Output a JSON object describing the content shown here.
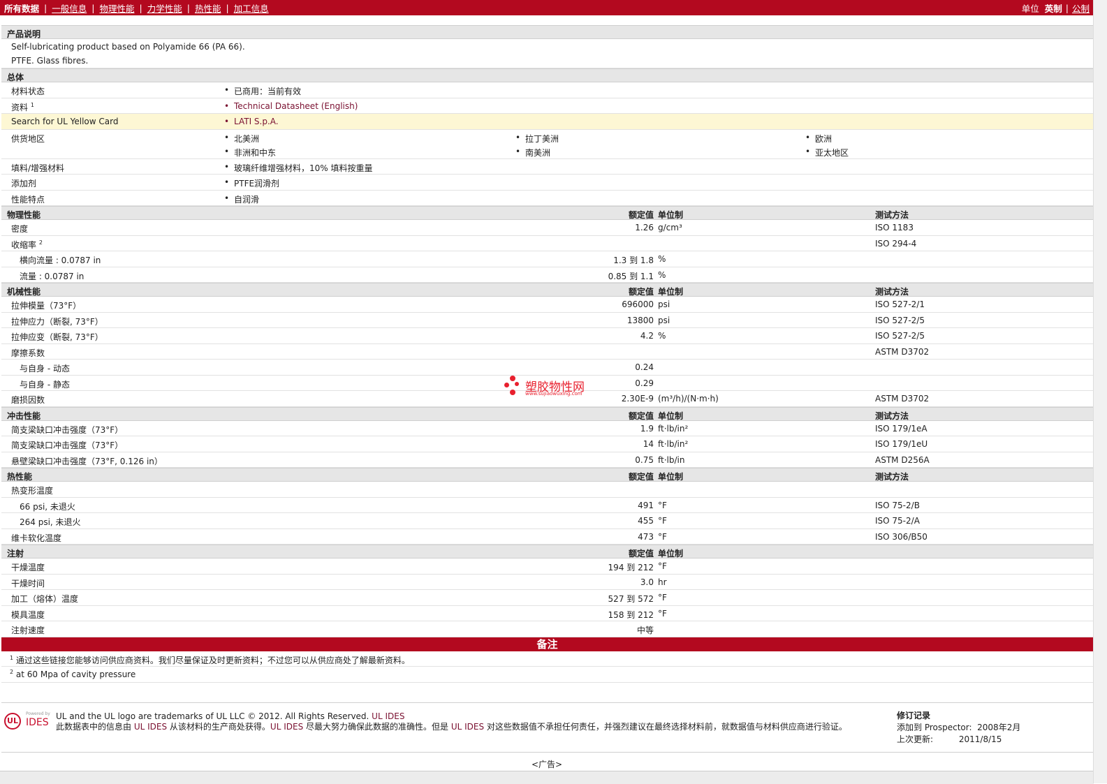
{
  "nav": {
    "items": [
      "所有数据",
      "一般信息",
      "物理性能",
      "力学性能",
      "热性能",
      "加工信息"
    ],
    "units_label": "单位",
    "unit_imperial": "英制",
    "unit_metric": "公制"
  },
  "product": {
    "header": "产品说明",
    "line1": "Self-lubricating product based on Polyamide 66 (PA 66).",
    "line2": "PTFE. Glass fibres."
  },
  "general": {
    "header": "总体",
    "material_status_label": "材料状态",
    "material_status_value": "已商用：当前有效",
    "docs_label": "资料",
    "docs_sup": "1",
    "docs_value": "Technical Datasheet (English)",
    "ul_label": "Search for UL Yellow Card",
    "ul_value": "LATI S.p.A.",
    "supply_label": "供货地区",
    "regions": [
      "北美洲",
      "拉丁美洲",
      "欧洲",
      "非洲和中东",
      "南美洲",
      "亚太地区"
    ],
    "filler_label": "填料/增强材料",
    "filler_value": "玻璃纤维增强材料，10% 填料按重量",
    "additive_label": "添加剂",
    "additive_value": "PTFE润滑剂",
    "feature_label": "性能特点",
    "feature_value": "自润滑"
  },
  "headers": {
    "value": "额定值",
    "unit": "单位制",
    "method": "测试方法"
  },
  "physical": {
    "header": "物理性能",
    "density": {
      "label": "密度",
      "value": "1.26",
      "unit": "g/cm³",
      "method": "ISO 1183"
    },
    "shrink": {
      "label": "收缩率",
      "sup": "2",
      "method": "ISO 294-4"
    },
    "shrink_cross": {
      "label": "横向流量 : 0.0787 in",
      "value": "1.3 到  1.8",
      "unit": "%"
    },
    "shrink_flow": {
      "label": "流量 : 0.0787 in",
      "value": "0.85 到  1.1",
      "unit": "%"
    }
  },
  "mechanical": {
    "header": "机械性能",
    "rows": [
      {
        "label": "拉伸模量（73°F）",
        "value": "696000",
        "unit": "psi",
        "method": "ISO 527-2/1"
      },
      {
        "label": "拉伸应力（断裂, 73°F）",
        "value": "13800",
        "unit": "psi",
        "method": "ISO 527-2/5"
      },
      {
        "label": "拉伸应变（断裂, 73°F）",
        "value": "4.2",
        "unit": "%",
        "method": "ISO 527-2/5"
      }
    ],
    "friction": {
      "label": "摩擦系数",
      "method": "ASTM D3702"
    },
    "friction_dyn": {
      "label": "与自身  - 动态",
      "value": "0.24"
    },
    "friction_sta": {
      "label": "与自身  - 静态",
      "value": "0.29"
    },
    "wear": {
      "label": "磨损因数",
      "value": "2.30E-9",
      "unit": "(m³/h)/(N·m·h)",
      "method": "ASTM D3702"
    }
  },
  "impact": {
    "header": "冲击性能",
    "rows": [
      {
        "label": "简支梁缺口冲击强度（73°F）",
        "value": "1.9",
        "unit": "ft·lb/in²",
        "method": "ISO 179/1eA"
      },
      {
        "label": "简支梁缺口冲击强度（73°F）",
        "value": "14",
        "unit": "ft·lb/in²",
        "method": "ISO 179/1eU"
      },
      {
        "label": "悬壁梁缺口冲击强度（73°F, 0.126 in）",
        "value": "0.75",
        "unit": "ft·lb/in",
        "method": "ASTM D256A"
      }
    ]
  },
  "thermal": {
    "header": "热性能",
    "hdt": {
      "label": "热变形温度"
    },
    "hdt66": {
      "label": "66 psi, 未退火",
      "value": "491",
      "unit": "°F",
      "method": "ISO 75-2/B"
    },
    "hdt264": {
      "label": "264 psi, 未退火",
      "value": "455",
      "unit": "°F",
      "method": "ISO 75-2/A"
    },
    "vicat": {
      "label": "维卡软化温度",
      "value": "473",
      "unit": "°F",
      "method": "ISO 306/B50"
    }
  },
  "injection": {
    "header": "注射",
    "rows": [
      {
        "label": "干燥温度",
        "value": "194 到  212",
        "unit": "°F"
      },
      {
        "label": "干燥时间",
        "value": "3.0",
        "unit": "hr"
      },
      {
        "label": "加工（熔体）温度",
        "value": "527 到  572",
        "unit": "°F"
      },
      {
        "label": "模具温度",
        "value": "158 到  212",
        "unit": "°F"
      },
      {
        "label": "注射速度",
        "value": "中等",
        "unit": ""
      }
    ]
  },
  "notes": {
    "header": "备注",
    "n1_sup": "1",
    "n1": "通过这些链接您能够访问供应商资料。我们尽量保证及时更新资料；不过您可以从供应商处了解最新资料。",
    "n2_sup": "2",
    "n2": "at 60 Mpa of cavity pressure"
  },
  "footer": {
    "logo_powered": "Powered by",
    "logo_ul": "UL",
    "logo_ides": "IDES",
    "line1a": "UL and the UL logo are trademarks of UL LLC © 2012. All Rights Reserved. ",
    "line1b": "UL IDES",
    "line2a": "此数据表中的信息由 ",
    "line2b": "UL IDES",
    "line2c": " 从该材料的生产商处获得。",
    "line2d": "UL IDES",
    "line2e": " 尽最大努力确保此数据的准确性。但是 ",
    "line2f": "UL IDES",
    "line2g": " 对这些数据值不承担任何责任，并强烈建议在最终选择材料前，就数据值与材料供应商进行验证。",
    "rev_title": "修订记录",
    "rev_added_label": "添加到  Prospector:",
    "rev_added": "2008年2月",
    "rev_updated_label": "上次更新:",
    "rev_updated": "2011/8/15"
  },
  "ad": "<广告>",
  "watermark": {
    "text": "塑胶物性网",
    "url": "www.sujiaowuxing.com"
  }
}
